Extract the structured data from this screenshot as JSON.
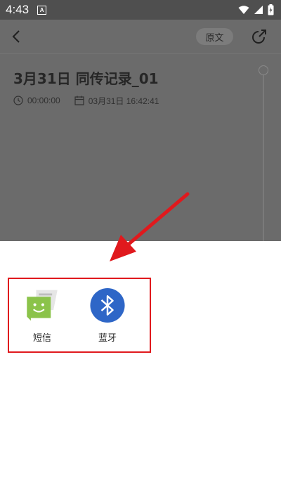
{
  "status_bar": {
    "time": "4:43",
    "notification_glyph": "A",
    "icons": [
      "wifi-icon",
      "signal-icon",
      "battery-charging-icon"
    ]
  },
  "header": {
    "back_icon": "back-icon",
    "source_button_label": "原文",
    "share_icon": "share-icon"
  },
  "record": {
    "title": "3月31日 同传记录_01",
    "duration": "00:00:00",
    "datetime": "03月31日 16:42:41"
  },
  "share_sheet": {
    "options": [
      {
        "label": "短信",
        "icon": "sms-message-icon"
      },
      {
        "label": "蓝牙",
        "icon": "bluetooth-icon"
      }
    ]
  },
  "colors": {
    "dim_overlay": "#6b6b6b",
    "annotation_red": "#e0191d",
    "sms_green": "#8bc34a",
    "bluetooth_blue": "#2e66c7"
  }
}
